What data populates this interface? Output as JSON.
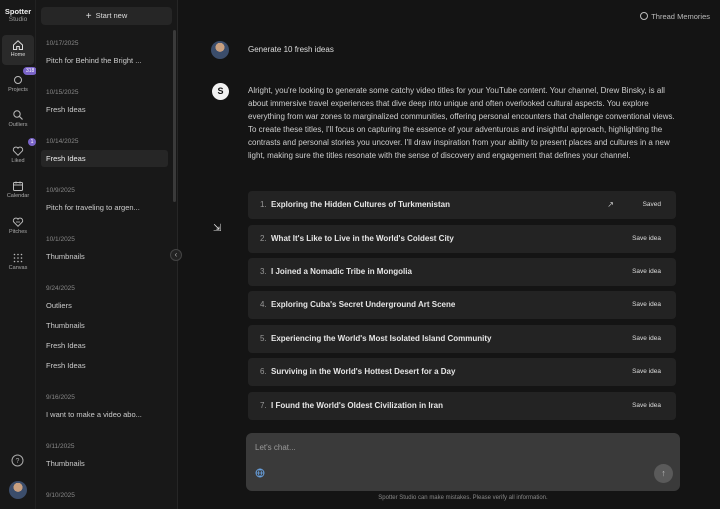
{
  "brand": {
    "line1": "Spotter",
    "line2": "Studio"
  },
  "nav": [
    {
      "id": "home",
      "label": "Home"
    },
    {
      "id": "projects",
      "label": "Projects",
      "badge": "318"
    },
    {
      "id": "outliers",
      "label": "Outliers"
    },
    {
      "id": "liked",
      "label": "Liked",
      "badge": "1"
    },
    {
      "id": "calendar",
      "label": "Calendar"
    },
    {
      "id": "pitches",
      "label": "Pitches"
    },
    {
      "id": "canvas",
      "label": "Canvas"
    }
  ],
  "history": {
    "new_chat": "Start new",
    "groups": [
      {
        "date": "10/17/2025",
        "items": [
          "Pitch for Behind the Bright ..."
        ]
      },
      {
        "date": "10/15/2025",
        "items": [
          "Fresh Ideas"
        ]
      },
      {
        "date": "10/14/2025",
        "items": [
          "Fresh Ideas"
        ]
      },
      {
        "date": "10/9/2025",
        "items": [
          "Pitch for traveling to argen..."
        ]
      },
      {
        "date": "10/1/2025",
        "items": [
          "Thumbnails"
        ]
      },
      {
        "date": "9/24/2025",
        "items": [
          "Outliers",
          "Thumbnails",
          "Fresh Ideas",
          "Fresh Ideas"
        ]
      },
      {
        "date": "9/16/2025",
        "items": [
          "I want to make a video abo..."
        ]
      },
      {
        "date": "9/11/2025",
        "items": [
          "Thumbnails"
        ]
      },
      {
        "date": "9/10/2025",
        "items": []
      }
    ]
  },
  "thread_memories": "Thread Memories",
  "user_prompt": "Generate 10 fresh ideas",
  "assistant": {
    "avatar_letter": "S",
    "intro": "Alright, you're looking to generate some catchy video titles for your YouTube content. Your channel, Drew Binsky, is all about immersive travel experiences that dive deep into unique and often overlooked cultural aspects. You explore everything from war zones to marginalized communities, offering personal encounters that challenge conventional views. To create these titles, I'll focus on capturing the essence of your adventurous and insightful approach, highlighting the contrasts and personal stories you uncover. I'll draw inspiration from your ability to present places and cultures in a new light, making sure the titles resonate with the sense of discovery and engagement that defines your channel."
  },
  "ideas": [
    {
      "num": "1.",
      "title": "Exploring the Hidden Cultures of Turkmenistan",
      "action": "Saved",
      "saved": true
    },
    {
      "num": "2.",
      "title": "What It's Like to Live in the World's Coldest City",
      "action": "Save idea"
    },
    {
      "num": "3.",
      "title": "I Joined a Nomadic Tribe in Mongolia",
      "action": "Save idea"
    },
    {
      "num": "4.",
      "title": "Exploring Cuba's Secret Underground Art Scene",
      "action": "Save idea"
    },
    {
      "num": "5.",
      "title": "Experiencing the World's Most Isolated Island Community",
      "action": "Save idea"
    },
    {
      "num": "6.",
      "title": "Surviving in the World's Hottest Desert for a Day",
      "action": "Save idea"
    },
    {
      "num": "7.",
      "title": "I Found the World's Oldest Civilization in Iran",
      "action": "Save idea"
    }
  ],
  "composer": {
    "placeholder": "Let's chat..."
  },
  "disclaimer": "Spotter Studio can make mistakes. Please verify all information."
}
